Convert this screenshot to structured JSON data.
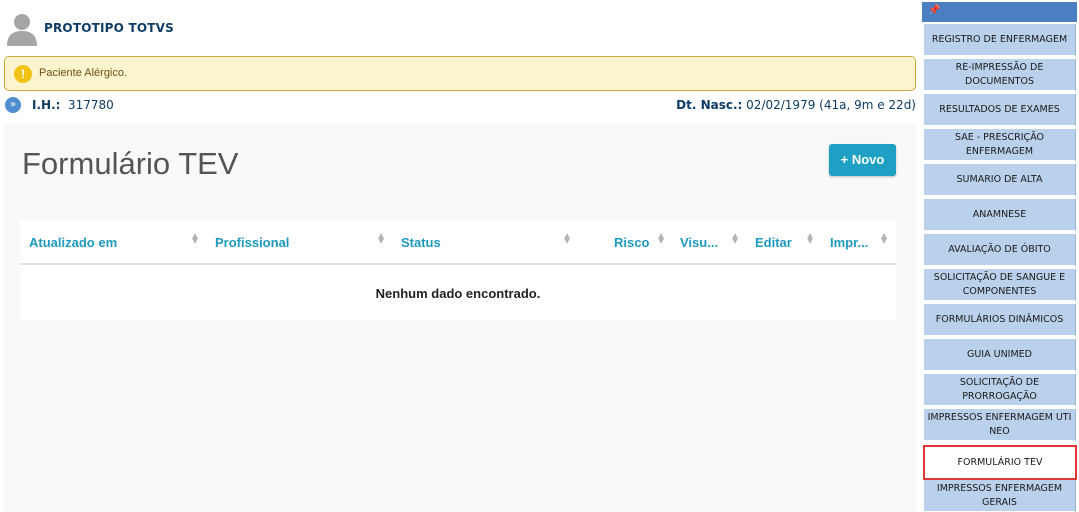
{
  "patient": {
    "name": "PROTOTIPO TOTVS",
    "alert": "Paciente Alérgico.",
    "alert_icon": "exclamation-icon",
    "ih_label": "I.H.:",
    "ih_value": "317780",
    "dt_nasc_label": "Dt. Nasc.:",
    "dt_nasc_value": "02/02/1979 (41a, 9m e 22d)"
  },
  "main": {
    "title": "Formulário TEV",
    "new_button": "+ Novo",
    "table": {
      "columns": [
        "Atualizado em",
        "Profissional",
        "Status",
        "Risco",
        "Visu...",
        "Editar",
        "Impr..."
      ],
      "empty_message": "Nenhum dado encontrado."
    }
  },
  "sidebar": {
    "items": [
      {
        "label": "REGISTRO DE ENFERMAGEM"
      },
      {
        "label": "RE-IMPRESSÃO DE DOCUMENTOS"
      },
      {
        "label": "RESULTADOS DE EXAMES"
      },
      {
        "label": "SAE - PRESCRIÇÃO ENFERMAGEM"
      },
      {
        "label": "SUMARIO DE ALTA"
      },
      {
        "label": "ANAMNESE"
      },
      {
        "label": "AVALIAÇÃO DE ÓBITO"
      },
      {
        "label": "SOLICITAÇÃO DE SANGUE E COMPONENTES"
      },
      {
        "label": "FORMULÁRIOS DINÂMICOS"
      },
      {
        "label": "GUIA UNIMED"
      },
      {
        "label": "SOLICITAÇÃO DE PRORROGAÇÃO"
      },
      {
        "label": "IMPRESSOS ENFERMAGEM  UTI NEO"
      },
      {
        "label": "FORMULÁRIO TEV"
      },
      {
        "label": "IMPRESSOS ENFERMAGEM  GERAIS"
      }
    ],
    "active_index": 12
  },
  "colors": {
    "accent": "#1da0c4",
    "sidebar_item": "#b9d1ea",
    "active_border": "#e0393a",
    "alert_bg": "#fcf3cf"
  }
}
